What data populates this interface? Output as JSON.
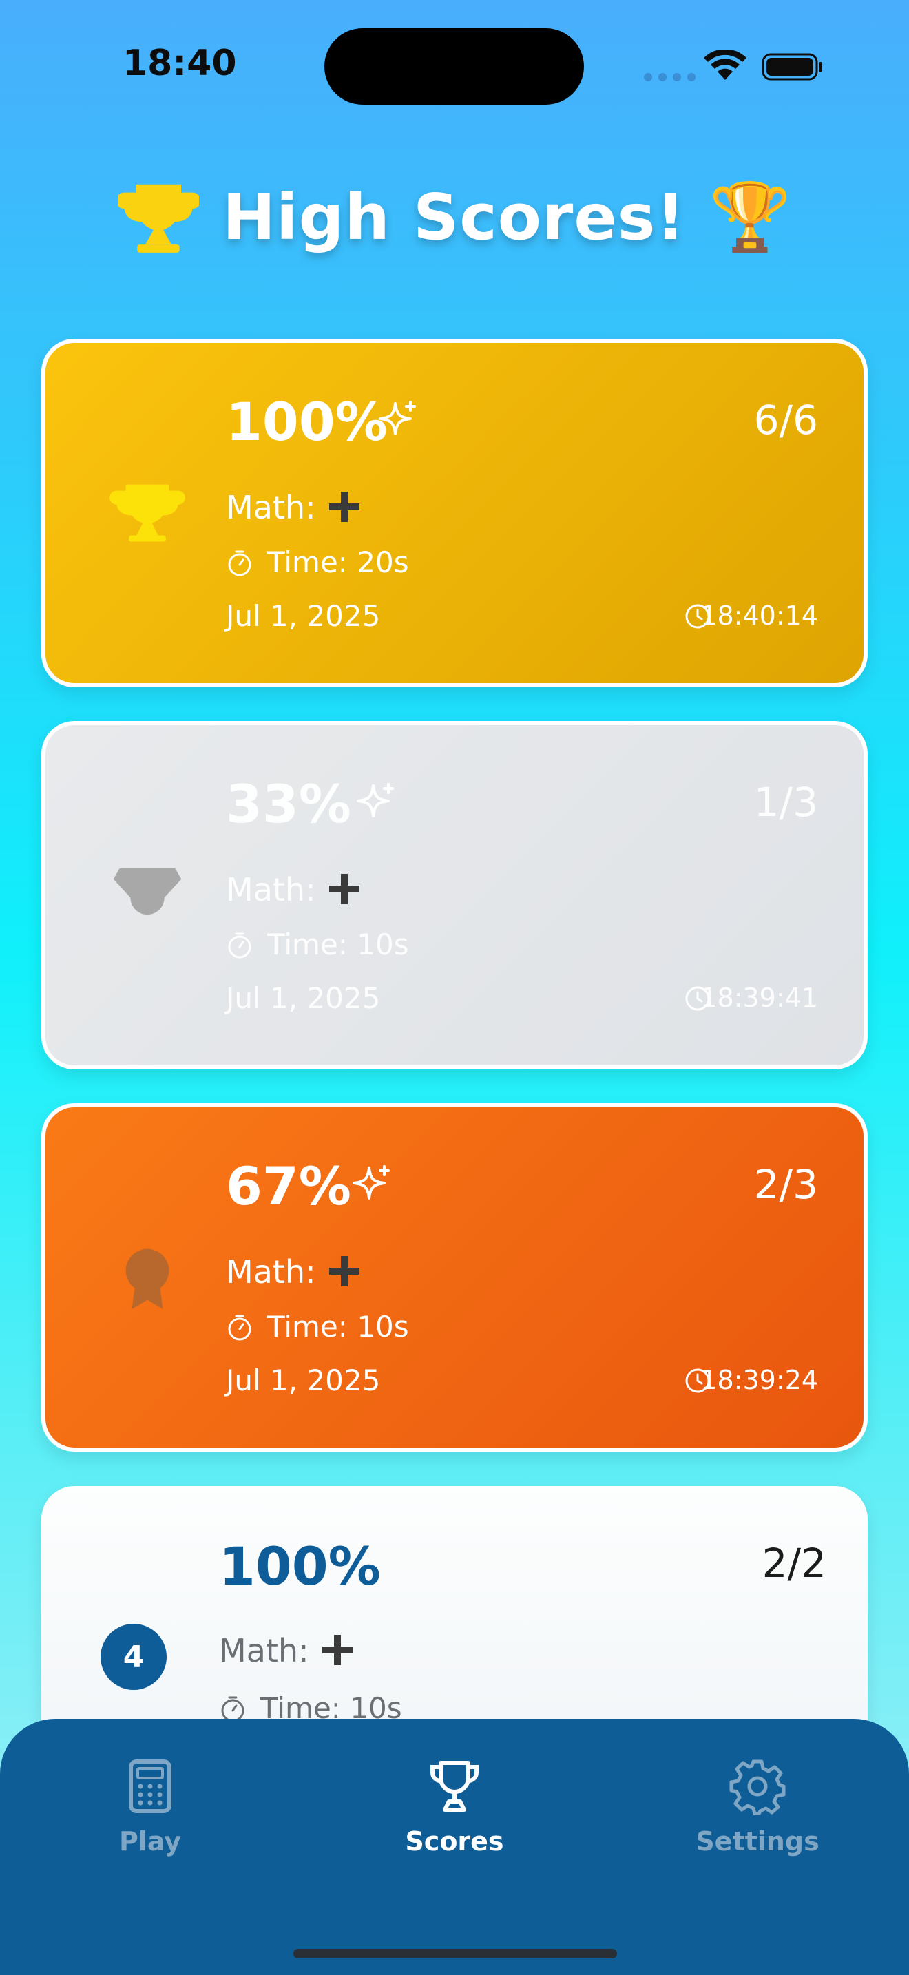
{
  "status_bar": {
    "time": "18:40"
  },
  "header": {
    "title": "High Scores!",
    "trophy_emoji": "🏆"
  },
  "scores": [
    {
      "rank": 1,
      "medal": "gold-trophy-icon",
      "percent": "100%",
      "fraction": "6/6",
      "math_label": "Math:",
      "operation": "plus-icon",
      "time": "Time: 20s",
      "date": "Jul 1, 2025",
      "clock": "18:40:14"
    },
    {
      "rank": 2,
      "medal": "silver-trophy-icon",
      "percent": "33%",
      "fraction": "1/3",
      "math_label": "Math:",
      "operation": "plus-icon",
      "time": "Time: 10s",
      "date": "Jul 1, 2025",
      "clock": "18:39:41"
    },
    {
      "rank": 3,
      "medal": "bronze-medal-icon",
      "percent": "67%",
      "fraction": "2/3",
      "math_label": "Math:",
      "operation": "plus-icon",
      "time": "Time: 10s",
      "date": "Jul 1, 2025",
      "clock": "18:39:24"
    },
    {
      "rank": "4",
      "percent": "100%",
      "fraction": "2/2",
      "math_label": "Math:",
      "operation": "plus-icon",
      "time": "Time: 10s"
    }
  ],
  "tabs": [
    {
      "label": "Play",
      "icon": "calculator-icon",
      "active": false
    },
    {
      "label": "Scores",
      "icon": "trophy-icon",
      "active": true
    },
    {
      "label": "Settings",
      "icon": "gear-icon",
      "active": false
    }
  ],
  "colors": {
    "gold": "#fbc40d",
    "silver": "#e4e7ea",
    "bronze": "#f26c13",
    "brand_blue": "#0e5d96"
  }
}
